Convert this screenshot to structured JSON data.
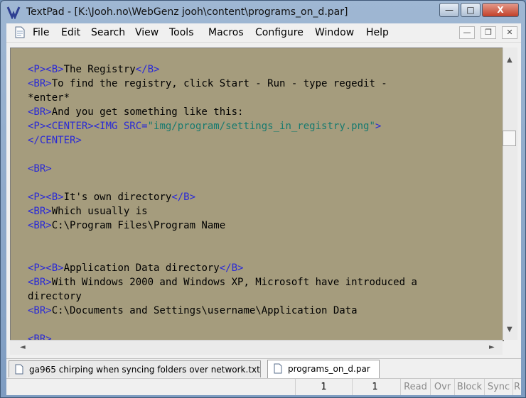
{
  "window": {
    "title": "TextPad - [K:\\Jooh.no\\WebGenz jooh\\content\\programs_on_d.par]",
    "min_label": "—",
    "max_label": "□",
    "close_label": "X"
  },
  "menu": {
    "items": [
      "File",
      "Edit",
      "Search",
      "View",
      "Tools",
      "Macros",
      "Configure",
      "Window",
      "Help"
    ],
    "mdi_min": "—",
    "mdi_restore": "❐",
    "mdi_close": "✕"
  },
  "editor": {
    "lines": [
      "<P><B>The Registry</B>",
      "<BR>To find the registry, click Start - Run - type regedit -",
      "*enter*",
      "<BR>And you get something like this:",
      "<P><CENTER><IMG SRC=\"img/program/settings_in_registry.png\">",
      "</CENTER>",
      "",
      "<BR>",
      "",
      "<P><B>It's own directory</B>",
      "<BR>Which usually is",
      "<BR>C:\\Program Files\\Program Name",
      "",
      "",
      "<P><B>Application Data directory</B>",
      "<BR>With Windows 2000 and Windows XP, Microsoft have introduced a",
      "directory",
      "<BR>C:\\Documents and Settings\\username\\Application Data",
      "",
      "<BR>"
    ]
  },
  "tabs": [
    {
      "label": "ga965 chirping when syncing folders over network.txt",
      "active": false
    },
    {
      "label": "programs_on_d.par",
      "active": true
    }
  ],
  "status": {
    "line": "1",
    "col": "1",
    "read": "Read",
    "ovr": "Ovr",
    "block": "Block",
    "sync": "Sync",
    "rec": "R"
  },
  "colors": {
    "editor_bg": "#a59c7d",
    "tag": "#2a2ad6",
    "string": "#177a6f"
  }
}
